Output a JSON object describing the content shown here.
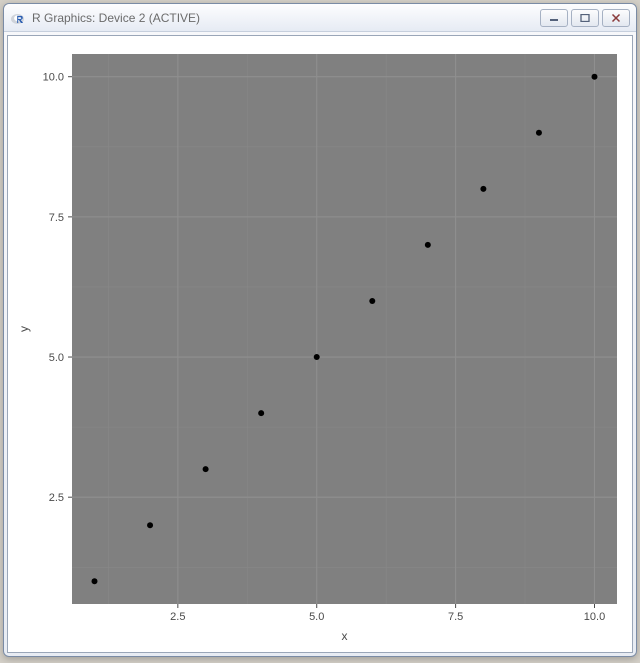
{
  "window": {
    "title": "R Graphics: Device 2 (ACTIVE)",
    "buttons": {
      "minimize": "minimize",
      "maximize": "maximize",
      "close": "close"
    }
  },
  "chart_data": {
    "type": "scatter",
    "x": [
      1,
      2,
      3,
      4,
      5,
      6,
      7,
      8,
      9,
      10
    ],
    "y": [
      1,
      2,
      3,
      4,
      5,
      6,
      7,
      8,
      9,
      10
    ],
    "xlabel": "x",
    "ylabel": "y",
    "x_ticks": [
      2.5,
      5.0,
      7.5,
      10.0
    ],
    "y_ticks": [
      2.5,
      5.0,
      7.5,
      10.0
    ],
    "x_tick_labels": [
      "2.5",
      "5.0",
      "7.5",
      "10.0"
    ],
    "y_tick_labels": [
      "2.5",
      "5.0",
      "7.5",
      "10.0"
    ],
    "xlim": [
      1,
      10
    ],
    "ylim": [
      1,
      10
    ],
    "panel_bg": "#808080",
    "grid_color": "#8f8f8f",
    "point_color": "#000000",
    "point_radius": 3
  }
}
